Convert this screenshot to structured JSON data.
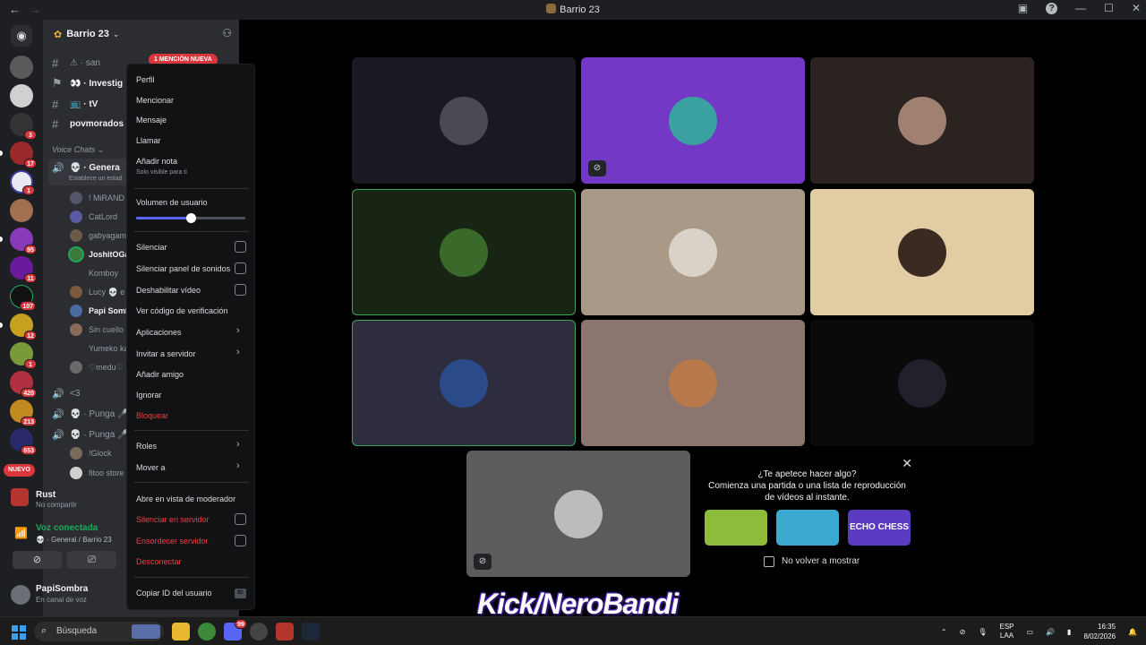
{
  "titlebar": {
    "title": "Barrio 23",
    "back": "←",
    "forward": "→",
    "min": "—",
    "max": "☐",
    "close": "✕"
  },
  "rail": {
    "badges": [
      "3",
      "17",
      "1",
      "95",
      "11",
      "107",
      "12",
      "1",
      "420",
      "213",
      "653"
    ],
    "nuevo": "NUEVO"
  },
  "sidebar": {
    "server_name": "Barrio 23",
    "mention_badge": "1 MENCIÓN NUEVA",
    "channels": [
      {
        "icon": "#",
        "label": "⚠ · san"
      },
      {
        "icon": "#",
        "label": "👀 · Investig"
      },
      {
        "icon": "#",
        "label": "📺 · tV"
      },
      {
        "icon": "#",
        "label": "povmorados"
      }
    ],
    "voice_category": "Voice Chats ⌄",
    "voice_channel": "💀 · Genera",
    "voice_status": "Establece un estad",
    "members": [
      "! MiRAND",
      "CatLord",
      "gabyagam",
      "JoshitOGa",
      "Komboy",
      "Lucy 💀 e",
      "Papi Somb",
      "Sin cuello",
      "Yumeko ka",
      "♡medu♡"
    ],
    "other_voice": [
      {
        "label": "<3"
      },
      {
        "label": "💀 · Punga 🎤"
      },
      {
        "label": "💀 · Punga 🎤"
      }
    ],
    "punga_members": [
      "!Glock",
      "fitoo store"
    ],
    "activity_title": "Rust",
    "activity_sub": "No compartir",
    "voice_connected": "Voz conectada",
    "voice_connected_sub": "💀 · General / Barrio 23",
    "user_name": "PapiSombra",
    "user_status": "En canal de voz"
  },
  "context_menu": {
    "items": {
      "perfil": "Perfil",
      "mencionar": "Mencionar",
      "mensaje": "Mensaje",
      "llamar": "Llamar",
      "nota": "Añadir nota",
      "nota_sub": "Solo visible para ti",
      "volumen": "Volumen de usuario",
      "silenciar": "Silenciar",
      "silenciar_sonidos": "Silenciar panel de sonidos",
      "deshabilitar_video": "Deshabilitar vídeo",
      "verificacion": "Ver código de verificación",
      "aplicaciones": "Aplicaciones",
      "invitar": "Invitar a servidor",
      "anadir_amigo": "Añadir amigo",
      "ignorar": "Ignorar",
      "bloquear": "Bloquear",
      "roles": "Roles",
      "mover": "Mover a",
      "moderador": "Abre en vista de moderador",
      "silenciar_servidor": "Silenciar en servidor",
      "ensordecer_servidor": "Ensordecer servidor",
      "desconectar": "Desconectar",
      "copiar_id": "Copiar ID del usuario",
      "id_tag": "ID"
    },
    "volume_fraction": 0.5
  },
  "promo": {
    "line1": "¿Te apetece hacer algo?",
    "line2": "Comienza una partida o una lista de reproducción",
    "line3": "de vídeos al instante.",
    "game3_title": "ECHO CHESS",
    "checkbox_label": "No volver a mostrar"
  },
  "overlay_text": "Kick/NeroBandi",
  "taskbar": {
    "search": "Búsqueda",
    "lang_top": "ESP",
    "lang_bottom": "LAA",
    "time": "16:35",
    "date": "8/02/2026",
    "discord_badge": "99"
  }
}
